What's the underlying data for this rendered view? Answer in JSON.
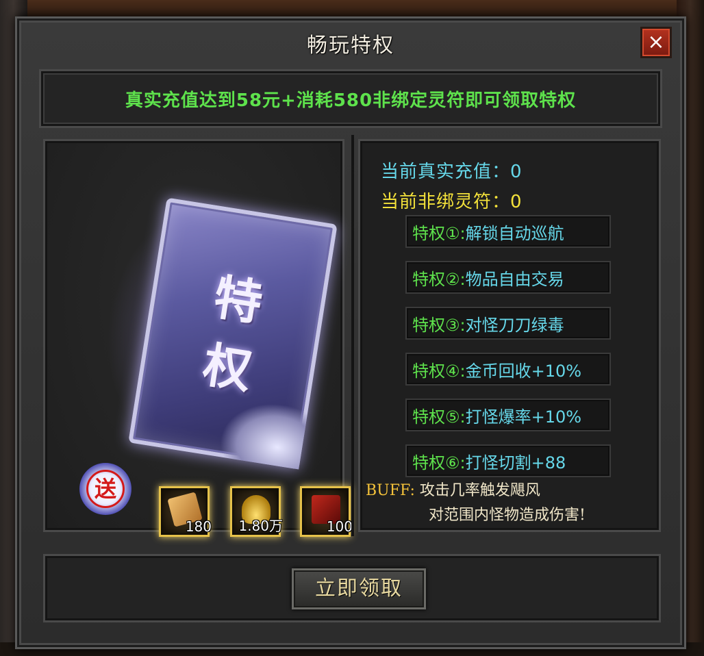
{
  "dialog": {
    "title": "畅玩特权",
    "close_label": "×"
  },
  "banner": {
    "text": "真实充值达到58元+消耗580非绑定灵符即可领取特权"
  },
  "card": {
    "char1": "特",
    "char2": "权"
  },
  "gift": {
    "seal_label": "送",
    "items": [
      {
        "icon": "scroll-icon",
        "count": "180"
      },
      {
        "icon": "gold-ingot-icon",
        "count": "1.80万"
      },
      {
        "icon": "red-book-icon",
        "count": "100"
      }
    ]
  },
  "stats": {
    "recharge": "当前真实充值：0",
    "talisman": "当前非绑灵符：0"
  },
  "privileges": [
    {
      "label": "特权①:",
      "desc": "解锁自动巡航"
    },
    {
      "label": "特权②:",
      "desc": "物品自由交易"
    },
    {
      "label": "特权③:",
      "desc": "对怪刀刀绿毒"
    },
    {
      "label": "特权④:",
      "desc": "金币回收+10%"
    },
    {
      "label": "特权⑤:",
      "desc": "打怪爆率+10%"
    },
    {
      "label": "特权⑥:",
      "desc": "打怪切割+88"
    }
  ],
  "buff": {
    "label": "BUFF:",
    "line1": "攻击几率触发飓风",
    "line2": "对范围内怪物造成伤害!"
  },
  "footer": {
    "claim_label": "立即领取"
  }
}
